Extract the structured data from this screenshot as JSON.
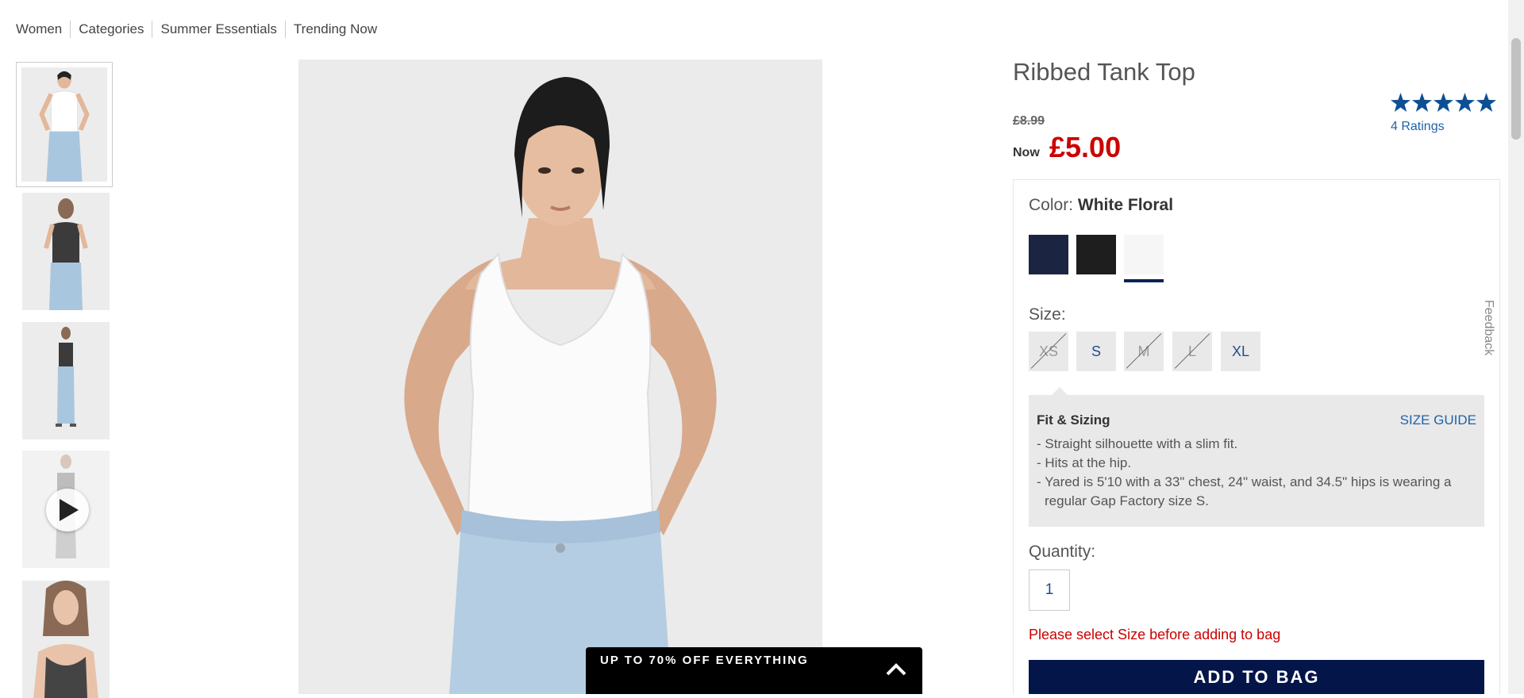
{
  "breadcrumb": [
    "Women",
    "Categories",
    "Summer Essentials",
    "Trending Now"
  ],
  "thumbnails": [
    "front-view",
    "back-view",
    "full-body-view",
    "video",
    "close-up-view"
  ],
  "promo": {
    "text": "UP TO 70% OFF EVERYTHING",
    "icon": "chevron-up-icon"
  },
  "product": {
    "title": "Ribbed Tank Top",
    "old_price": "£8.99",
    "now_label": "Now",
    "price": "£5.00",
    "rating": {
      "stars": 5,
      "label": "4 Ratings"
    }
  },
  "color": {
    "label": "Color:",
    "selected": "White Floral",
    "swatches": [
      {
        "name": "navy",
        "hex": "#1b2541"
      },
      {
        "name": "black",
        "hex": "#1e1e1e"
      },
      {
        "name": "white-floral",
        "hex": "#f6f6f6",
        "selected": true
      }
    ]
  },
  "size": {
    "label": "Size:",
    "options": [
      {
        "label": "XS",
        "available": false
      },
      {
        "label": "S",
        "available": true
      },
      {
        "label": "M",
        "available": false
      },
      {
        "label": "L",
        "available": false
      },
      {
        "label": "XL",
        "available": true
      }
    ]
  },
  "fit": {
    "title": "Fit & Sizing",
    "guide": "SIZE GUIDE",
    "items": [
      "- Straight silhouette with a slim fit.",
      "- Hits at the hip.",
      "- Yared is 5'10 with a 33\" chest, 24\" waist, and 34.5\" hips is wearing a regular Gap Factory size S."
    ]
  },
  "quantity": {
    "label": "Quantity:",
    "value": "1"
  },
  "warning": "Please select Size before adding to bag",
  "add_to_bag": "ADD TO BAG",
  "feedback": "Feedback",
  "colors": {
    "accent_blue": "#1f63a8",
    "navy_button": "#04154a",
    "sale_red": "#cc0000"
  }
}
